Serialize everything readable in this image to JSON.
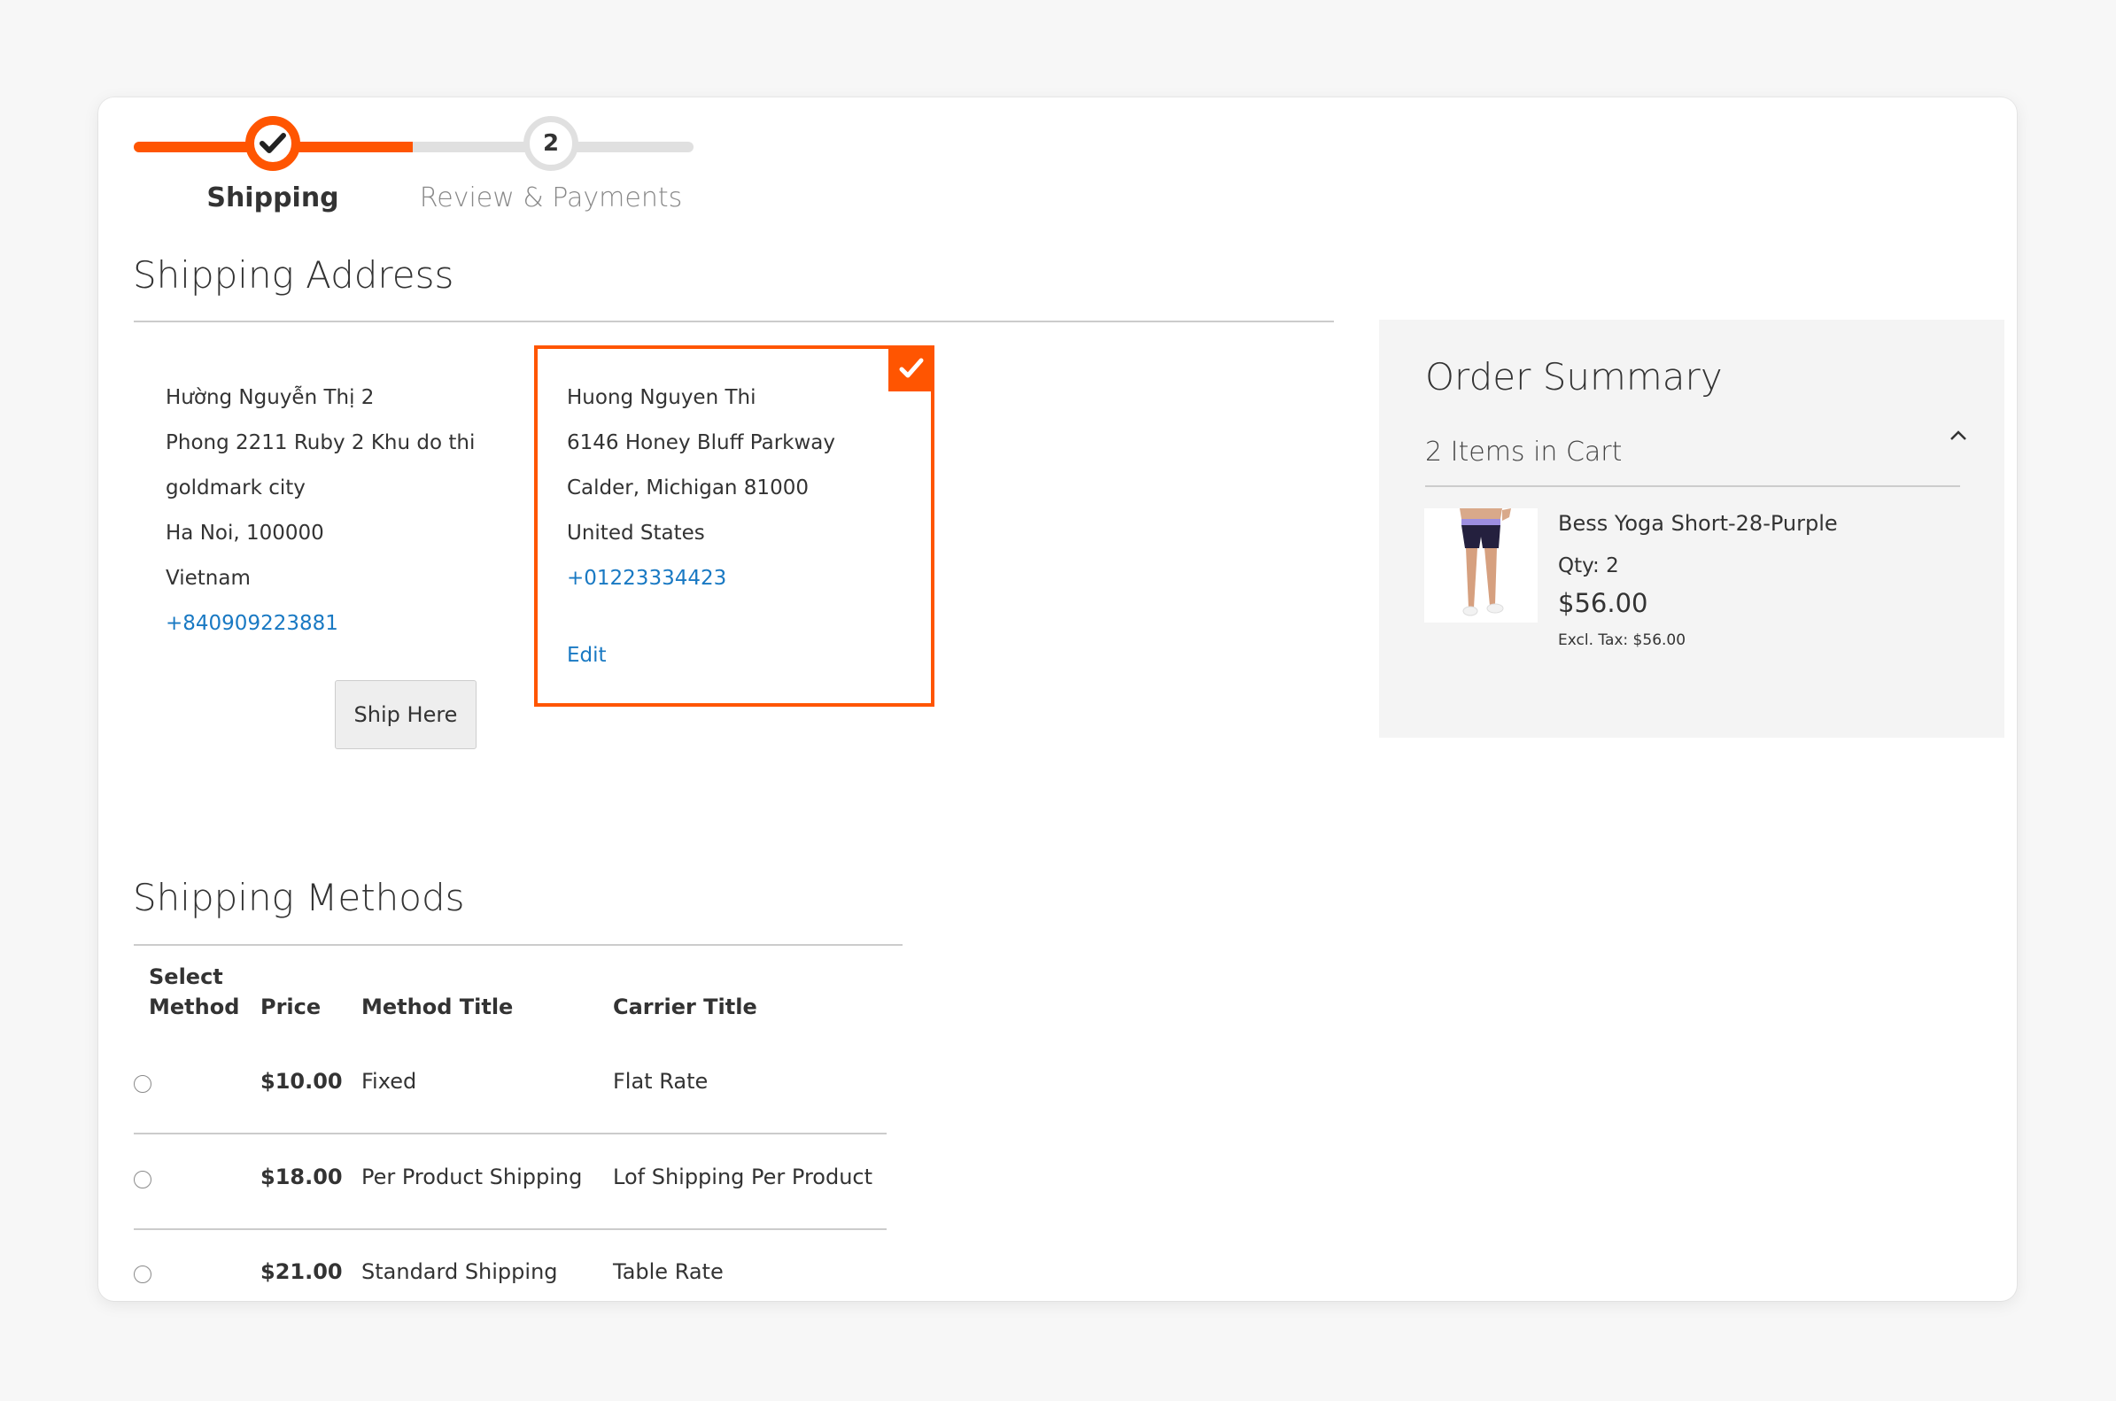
{
  "colors": {
    "accent": "#ff5501",
    "link": "#1979c3",
    "summary_bg": "#f4f4f4"
  },
  "progress": {
    "steps": [
      {
        "number": "1",
        "label": "Shipping",
        "state": "complete",
        "icon": "checkmark-icon"
      },
      {
        "number": "2",
        "label": "Review & Payments",
        "state": "upcoming"
      }
    ]
  },
  "shipping_address": {
    "title": "Shipping Address",
    "addresses": [
      {
        "lines": [
          "Hường Nguyễn Thị 2",
          "Phong 2211 Ruby 2 Khu do thi",
          "goldmark city",
          "Ha Noi, 100000",
          "Vietnam"
        ],
        "phone": "+840909223881",
        "action_label": "Ship Here",
        "selected": false
      },
      {
        "lines": [
          "Huong Nguyen Thi",
          "6146 Honey Bluff Parkway",
          "Calder, Michigan 81000",
          "United States"
        ],
        "phone": "+01223334423",
        "action_label": "Edit",
        "selected": true
      }
    ]
  },
  "shipping_methods": {
    "title": "Shipping Methods",
    "columns": [
      "Select Method",
      "Price",
      "Method Title",
      "Carrier Title"
    ],
    "column_select_line1": "Select",
    "column_select_line2": "Method",
    "rows": [
      {
        "selected": false,
        "price": "$10.00",
        "method": "Fixed",
        "carrier": "Flat Rate"
      },
      {
        "selected": false,
        "price": "$18.00",
        "method": "Per Product Shipping",
        "carrier": "Lof Shipping Per Product"
      },
      {
        "selected": false,
        "price": "$21.00",
        "method": "Standard Shipping",
        "carrier": "Table Rate"
      }
    ]
  },
  "order_summary": {
    "title": "Order Summary",
    "items_count_label": "2 Items in Cart",
    "expanded": true,
    "items": [
      {
        "name": "Bess Yoga Short-28-Purple",
        "qty_label": "Qty: 2",
        "price": "$56.00",
        "excl_tax": "Excl. Tax: $56.00"
      }
    ]
  }
}
